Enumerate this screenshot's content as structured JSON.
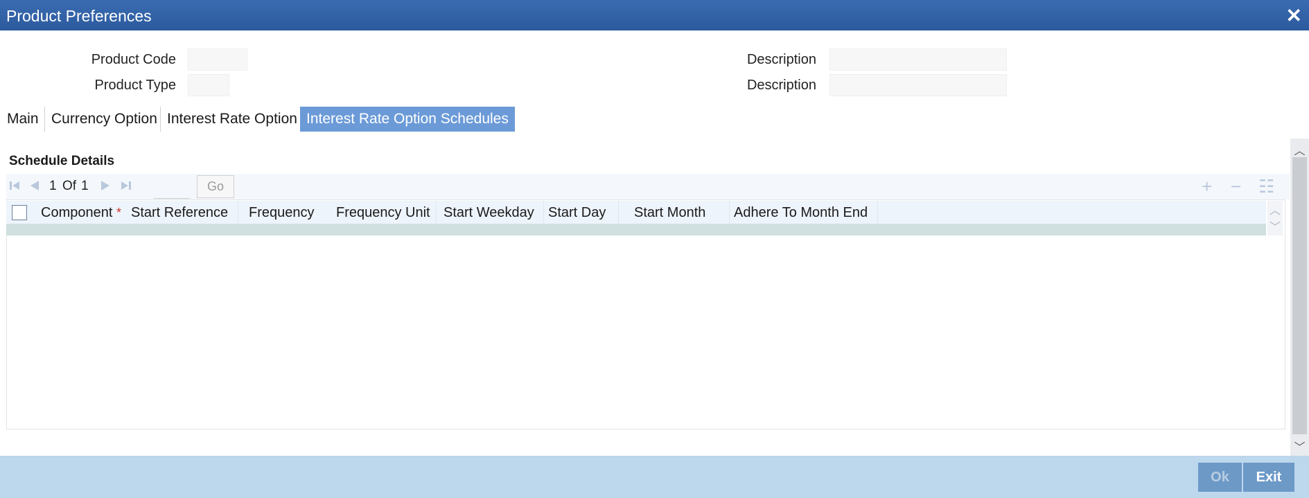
{
  "window": {
    "title": "Product Preferences",
    "close_label": "✕"
  },
  "header": {
    "product_code_label": "Product Code",
    "product_type_label": "Product Type",
    "description_label": "Description",
    "description2_label": "Description",
    "product_code_value": "",
    "product_type_value": "",
    "description_value": "",
    "description2_value": ""
  },
  "tabs": [
    {
      "label": "Main",
      "active": false
    },
    {
      "label": "Currency Option",
      "active": false
    },
    {
      "label": "Interest Rate Option",
      "active": false
    },
    {
      "label": "Interest Rate Option Schedules",
      "active": true
    }
  ],
  "section": {
    "title": "Schedule Details"
  },
  "pager": {
    "current": "1",
    "of_label": "Of",
    "total": "1",
    "go_label": "Go",
    "first_icon": "first-page-icon",
    "prev_icon": "prev-page-icon",
    "next_icon": "next-page-icon",
    "last_icon": "last-page-icon"
  },
  "grid_tools": {
    "add": "+",
    "remove": "−",
    "view": "☷"
  },
  "grid": {
    "required_marker": "*",
    "columns": [
      "Component",
      "Start Reference",
      "Frequency",
      "Frequency Unit",
      "Start Weekday",
      "Start Day",
      "Start Month",
      "Adhere To Month End"
    ],
    "rows": []
  },
  "footer": {
    "ok_label": "Ok",
    "exit_label": "Exit"
  },
  "colors": {
    "title_bar": "#2c5a9e",
    "active_tab": "#6b9ad7",
    "footer": "#bdd7ec",
    "button": "#6d99c7"
  }
}
